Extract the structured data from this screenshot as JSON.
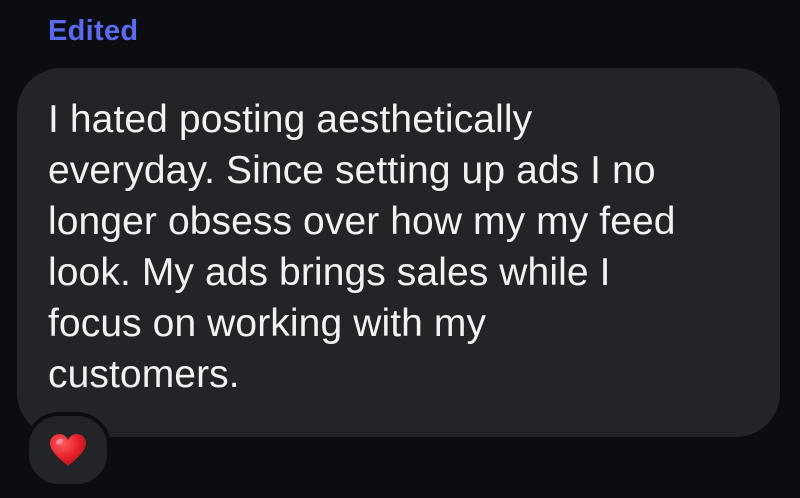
{
  "message": {
    "status_label": "Edited",
    "lines": [
      "I hated posting aesthetically",
      "everyday. Since setting up ads I no",
      "longer obsess over how my my feed",
      "look. My ads brings sales while I",
      "focus on working with my",
      "customers."
    ],
    "reaction": {
      "icon": "red-heart-icon",
      "color": "#e5202b"
    }
  },
  "colors": {
    "background": "#0c0d10",
    "bubble": "#232427",
    "text": "#f2f2f4",
    "accent": "#5b6bf0"
  }
}
